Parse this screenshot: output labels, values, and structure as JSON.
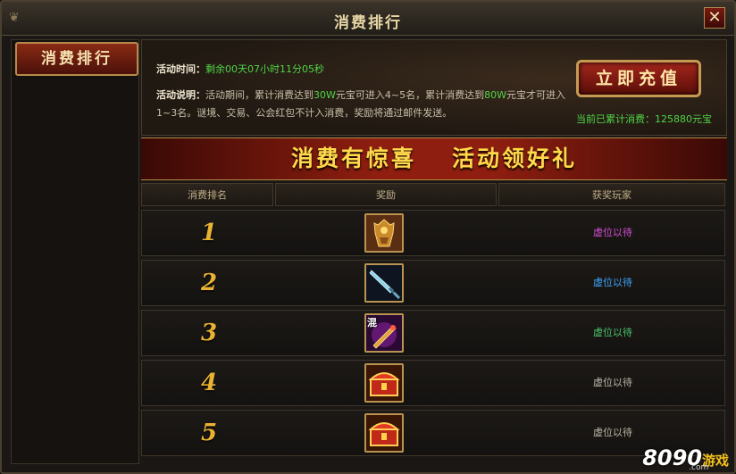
{
  "window": {
    "title": "消费排行",
    "close_label": "✕"
  },
  "sidebar": {
    "items": [
      {
        "label": "消费排行"
      }
    ]
  },
  "info": {
    "time_label": "活动时间：",
    "time_value": "剩余00天07小时11分05秒",
    "desc_label": "活动说明：",
    "desc_part1": "活动期间，累计消费达到",
    "desc_hl1": "30W",
    "desc_part2": "元宝可进入4~5名，累计消费达到",
    "desc_hl2": "80W",
    "desc_part3": "元宝才可进入1~3名。谜境、交易、公会红包不计入消费，奖励将通过邮件发送。",
    "recharge_label": "立即充值",
    "total_label": "当前已累计消费：",
    "total_value": "125880元宝"
  },
  "banner": {
    "left": "消费有惊喜",
    "right": "活动领好礼"
  },
  "table": {
    "headers": [
      "消费排名",
      "奖励",
      "获奖玩家"
    ],
    "rows": [
      {
        "rank": "1",
        "player": "虚位以待",
        "player_color": "#d24fd6",
        "reward_icon": "armor-icon"
      },
      {
        "rank": "2",
        "player": "虚位以待",
        "player_color": "#3fa6ff",
        "reward_icon": "sword-icon"
      },
      {
        "rank": "3",
        "player": "虚位以待",
        "player_color": "#49c46a",
        "reward_icon": "hybrid-weapon-icon",
        "reward_badge": "混"
      },
      {
        "rank": "4",
        "player": "虚位以待",
        "player_color": "#bdb6a8",
        "reward_icon": "treasure-chest-icon"
      },
      {
        "rank": "5",
        "player": "虚位以待",
        "player_color": "#bdb6a8",
        "reward_icon": "treasure-chest-icon"
      }
    ]
  },
  "watermark": {
    "num": "8090",
    "cn": "游戏",
    "domain": ".com"
  }
}
